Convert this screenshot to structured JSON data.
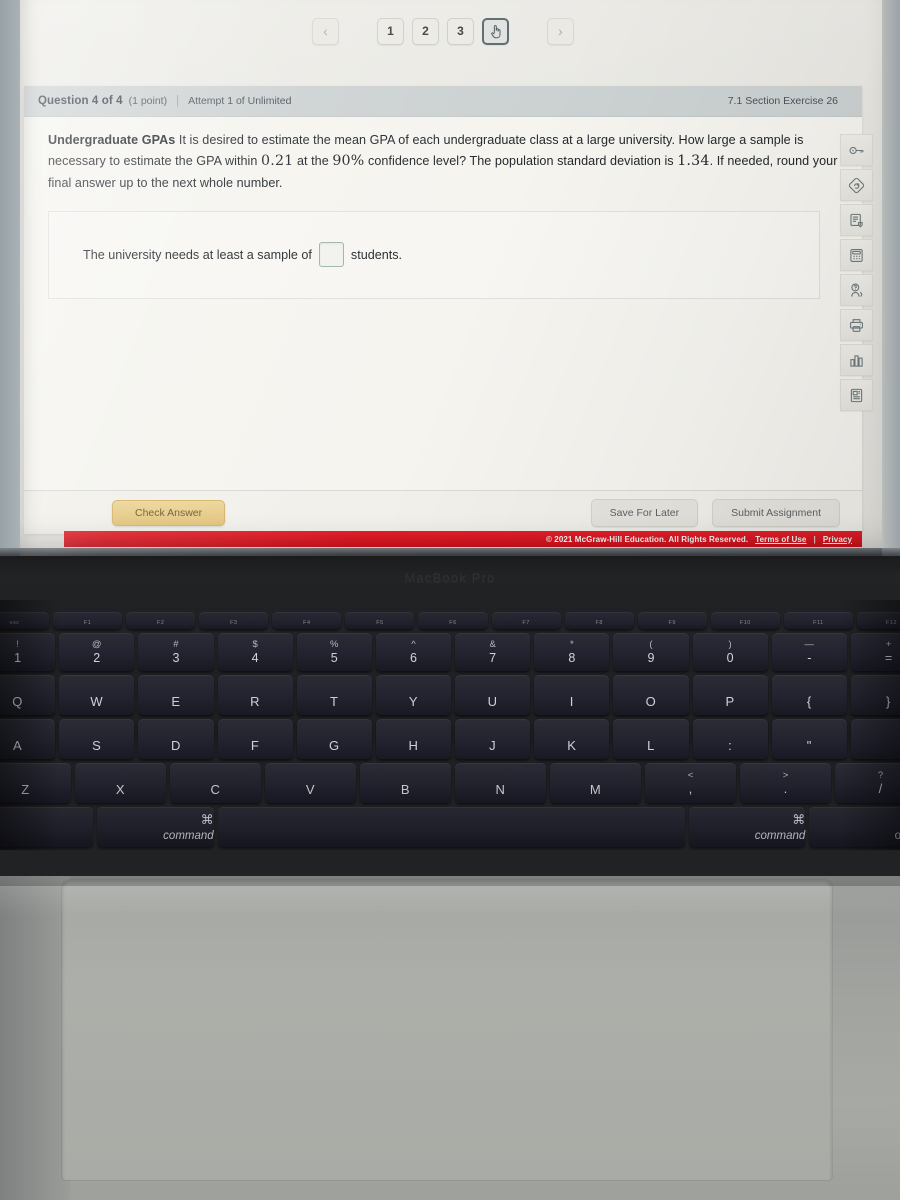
{
  "device": {
    "brand_label": "MacBook Pro"
  },
  "pagination": {
    "prev_icon": "chevron-left-icon",
    "next_icon": "chevron-right-icon",
    "prev_label": "‹",
    "next_label": "›",
    "pages": [
      "1",
      "2",
      "3"
    ],
    "current_page_icon": "pointing-hand-icon",
    "current_page": "4"
  },
  "question": {
    "header": {
      "title": "Question 4 of 4",
      "points": "(1 point)",
      "divider": "|",
      "attempt": "Attempt 1 of Unlimited",
      "exercise_ref": "7.1 Section Exercise 26"
    },
    "prompt": {
      "bold_lead": "Undergraduate GPAs",
      "part1": " It is desired to estimate the mean GPA of each undergraduate class at a large university. How large a sample is necessary to estimate the GPA within ",
      "margin_of_error": "0.21",
      "part2": " at the ",
      "confidence_level": "90%",
      "part3": " confidence level? The population standard deviation is ",
      "std_dev": "1.34",
      "part4": ". If needed, round your final answer up to the next whole number."
    },
    "answer": {
      "prefix": "The university needs at least a sample of",
      "value": "",
      "suffix": "students."
    }
  },
  "actions": {
    "check_answer": "Check Answer",
    "save_for_later": "Save For Later",
    "submit_assignment": "Submit Assignment"
  },
  "footer": {
    "copyright": "© 2021 McGraw-Hill Education. All Rights Reserved.",
    "terms": "Terms of Use",
    "separator": "|",
    "privacy": "Privacy",
    "bar_color": "#e0161f"
  },
  "toolbar": {
    "items": [
      {
        "icon": "key-icon",
        "label": "Answer Key"
      },
      {
        "icon": "diamond-refresh-icon",
        "label": "Regenerate Question"
      },
      {
        "icon": "notes-icon",
        "label": "Notes"
      },
      {
        "icon": "calculator-icon",
        "label": "Calculator"
      },
      {
        "icon": "help-person-icon",
        "label": "Ask Instructor"
      },
      {
        "icon": "printer-icon",
        "label": "Print"
      },
      {
        "icon": "bar-chart-icon",
        "label": "Statistics"
      },
      {
        "icon": "document-icon",
        "label": "Reference"
      }
    ]
  },
  "keyboard": {
    "function_row": [
      "esc",
      "F1",
      "F2",
      "F3",
      "F4",
      "F5",
      "F6",
      "F7",
      "F8",
      "F9",
      "F10",
      "F11",
      "F12"
    ],
    "number_row": [
      {
        "sup": "!",
        "main": "1"
      },
      {
        "sup": "@",
        "main": "2"
      },
      {
        "sup": "#",
        "main": "3"
      },
      {
        "sup": "$",
        "main": "4"
      },
      {
        "sup": "%",
        "main": "5"
      },
      {
        "sup": "^",
        "main": "6"
      },
      {
        "sup": "&",
        "main": "7"
      },
      {
        "sup": "*",
        "main": "8"
      },
      {
        "sup": "(",
        "main": "9"
      },
      {
        "sup": ")",
        "main": "0"
      },
      {
        "sup": "—",
        "main": "-"
      },
      {
        "sup": "+",
        "main": "="
      }
    ],
    "row_q": [
      "Q",
      "W",
      "E",
      "R",
      "T",
      "Y",
      "U",
      "I",
      "O",
      "P",
      "{",
      "}"
    ],
    "row_a": [
      "A",
      "S",
      "D",
      "F",
      "G",
      "H",
      "J",
      "K",
      "L",
      ":",
      "\"",
      ""
    ],
    "row_z": [
      {
        "sup": "",
        "main": "Z"
      },
      {
        "sup": "",
        "main": "X"
      },
      {
        "sup": "",
        "main": "C"
      },
      {
        "sup": "",
        "main": "V"
      },
      {
        "sup": "",
        "main": "B"
      },
      {
        "sup": "",
        "main": "N"
      },
      {
        "sup": "",
        "main": "M"
      },
      {
        "sup": "<",
        "main": ","
      },
      {
        "sup": ">",
        "main": "."
      },
      {
        "sup": "?",
        "main": "/"
      }
    ],
    "bottom_row": {
      "command_glyph": "⌘",
      "command_label": "command",
      "option_glyph": "⌥",
      "option_label": "option",
      "space_label": ""
    }
  }
}
